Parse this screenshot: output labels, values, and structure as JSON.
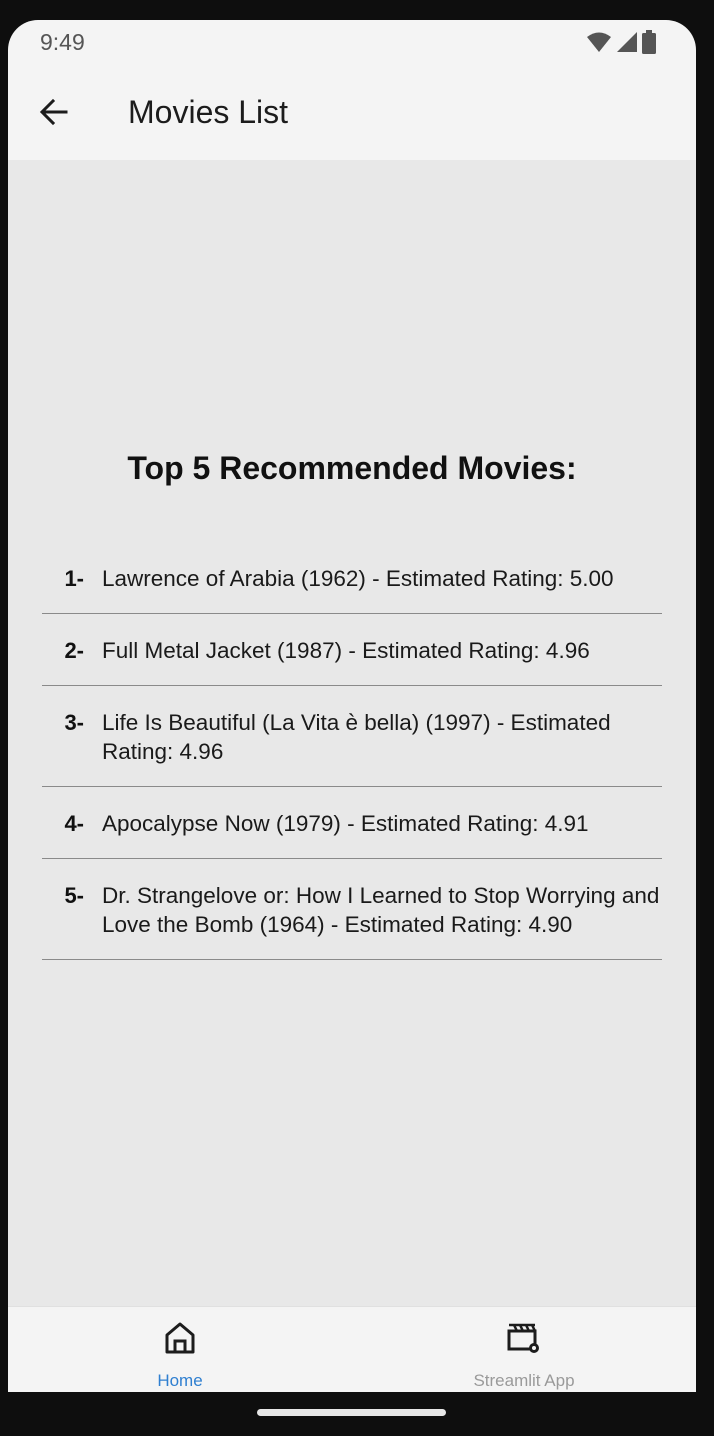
{
  "status_bar": {
    "time": "9:49",
    "icons": [
      "wifi-icon",
      "signal-icon",
      "battery-icon"
    ]
  },
  "app_bar": {
    "title": "Movies List",
    "back_icon": "arrow-left-icon"
  },
  "main": {
    "heading": "Top 5 Recommended Movies:",
    "movies": [
      {
        "rank": "1-",
        "text": "Lawrence of Arabia (1962) - Estimated Rating: 5.00"
      },
      {
        "rank": "2-",
        "text": "Full Metal Jacket (1987) - Estimated Rating: 4.96"
      },
      {
        "rank": "3-",
        "text": "Life Is Beautiful (La Vita è bella) (1997) - Estimated Rating: 4.96"
      },
      {
        "rank": "4-",
        "text": "Apocalypse Now (1979) - Estimated Rating: 4.91"
      },
      {
        "rank": "5-",
        "text": "Dr. Strangelove or: How I Learned to Stop Worrying and Love the Bomb (1964) - Estimated Rating: 4.90"
      }
    ]
  },
  "bottom_nav": {
    "items": [
      {
        "label": "Home",
        "icon": "home-icon",
        "active": true
      },
      {
        "label": "Streamlit App",
        "icon": "movie-settings-icon",
        "active": false
      }
    ]
  },
  "colors": {
    "active_tab": "#2f7fd0",
    "inactive_tab": "#9a9a9a",
    "content_bg": "#e8e8e8",
    "bar_bg": "#f4f4f4"
  }
}
